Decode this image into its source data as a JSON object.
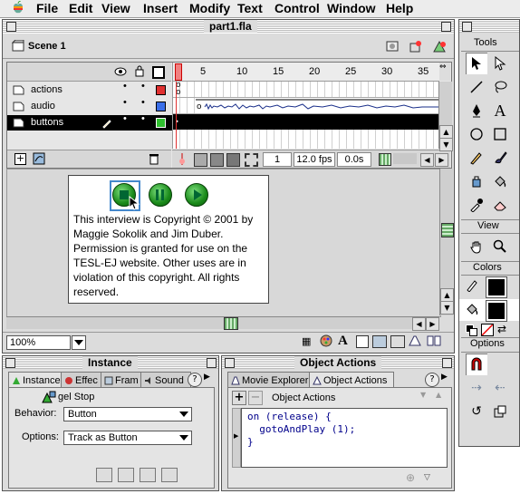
{
  "menubar": {
    "items": [
      "File",
      "Edit",
      "View",
      "Insert",
      "Modify",
      "Text",
      "Control",
      "Window",
      "Help"
    ]
  },
  "doc_window": {
    "title": "part1.fla",
    "scene": "Scene 1",
    "layers": [
      {
        "name": "actions",
        "color": "#e03030"
      },
      {
        "name": "audio",
        "color": "#3a6ee8"
      },
      {
        "name": "buttons",
        "color": "#30c030"
      }
    ],
    "ruler_ticks": [
      "5",
      "10",
      "15",
      "20",
      "25",
      "30",
      "35"
    ],
    "status": {
      "frame": "1",
      "fps": "12.0 fps",
      "time": "0.0s"
    },
    "zoom": "100%",
    "stage_text": "This interview is Copyright © 2001 by Maggie Sokolik and Jim Duber. Permission is granted for use on the TESL-EJ website. Other uses are in violation of this copyright. All rights reserved."
  },
  "instance_panel": {
    "title": "Instance",
    "tabs": [
      "Instance",
      "Effec",
      "Fram",
      "Sound"
    ],
    "symbol_name": "gel Stop",
    "behavior_label": "Behavior:",
    "behavior_value": "Button",
    "options_label": "Options:",
    "options_value": "Track as Button"
  },
  "actions_panel": {
    "title": "Object Actions",
    "tabs": [
      "Movie Explorer",
      "Object Actions"
    ],
    "header": "Object Actions",
    "code_lines": [
      "on (release) {",
      "  gotoAndPlay (1);",
      "}"
    ]
  },
  "tools_panel": {
    "title": "Tools",
    "view_label": "View",
    "colors_label": "Colors",
    "options_label": "Options"
  }
}
